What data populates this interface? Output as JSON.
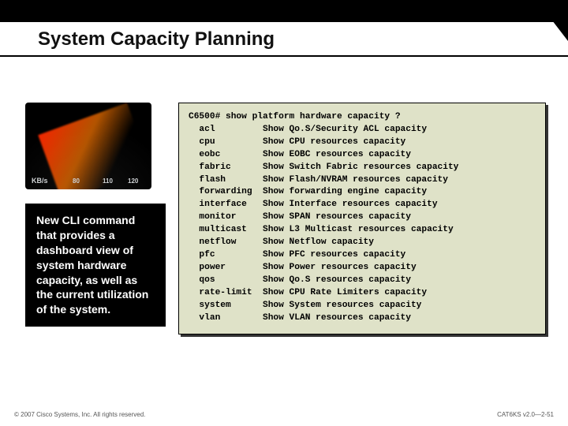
{
  "header": {
    "title": "System Capacity Planning"
  },
  "gauge": {
    "unit_label": "KB/s",
    "tick_a": "80",
    "tick_b": "110",
    "tick_c": "120"
  },
  "caption": {
    "text": "New CLI command that provides a dashboard view of system hardware capacity, as well as the current utilization of the system."
  },
  "cli": {
    "prompt": "C6500#",
    "command": "show platform hardware capacity ?",
    "rows": [
      {
        "kw": "acl",
        "desc": "Show Qo.S/Security ACL capacity"
      },
      {
        "kw": "cpu",
        "desc": "Show CPU resources capacity"
      },
      {
        "kw": "eobc",
        "desc": "Show EOBC resources capacity"
      },
      {
        "kw": "fabric",
        "desc": "Show Switch Fabric resources capacity"
      },
      {
        "kw": "flash",
        "desc": "Show Flash/NVRAM resources capacity"
      },
      {
        "kw": "forwarding",
        "desc": "Show forwarding engine capacity"
      },
      {
        "kw": "interface",
        "desc": "Show Interface resources capacity"
      },
      {
        "kw": "monitor",
        "desc": "Show SPAN resources capacity"
      },
      {
        "kw": "multicast",
        "desc": "Show L3 Multicast resources capacity"
      },
      {
        "kw": "netflow",
        "desc": "Show Netflow capacity"
      },
      {
        "kw": "pfc",
        "desc": "Show PFC resources capacity"
      },
      {
        "kw": "power",
        "desc": "Show Power resources capacity"
      },
      {
        "kw": "qos",
        "desc": "Show Qo.S resources capacity"
      },
      {
        "kw": "rate-limit",
        "desc": "Show CPU Rate Limiters capacity"
      },
      {
        "kw": "system",
        "desc": "Show System resources capacity"
      },
      {
        "kw": "vlan",
        "desc": "Show VLAN resources capacity"
      }
    ]
  },
  "footer": {
    "copyright": "© 2007 Cisco Systems, Inc. All rights reserved.",
    "page_ref": "CAT6KS v2.0—2-51"
  }
}
